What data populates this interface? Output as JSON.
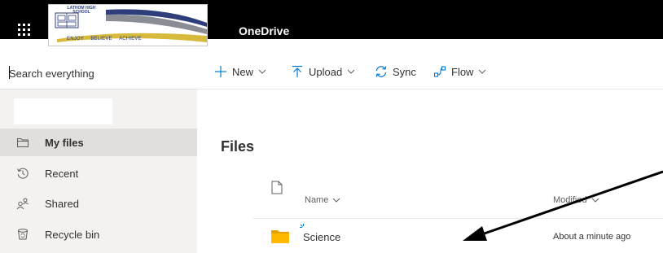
{
  "header": {
    "app_title": "OneDrive",
    "logo": {
      "school_name": "LATHOM HIGH SCHOOL",
      "motto_words": [
        "ENJOY",
        "BELIEVE",
        "ACHIEVE"
      ],
      "motto_separator": "•"
    }
  },
  "search": {
    "placeholder": "Search everything"
  },
  "nav": {
    "items": [
      {
        "label": "My files",
        "icon": "folder-outline-icon",
        "selected": true
      },
      {
        "label": "Recent",
        "icon": "history-icon",
        "selected": false
      },
      {
        "label": "Shared",
        "icon": "people-icon",
        "selected": false
      },
      {
        "label": "Recycle bin",
        "icon": "recycle-bin-icon",
        "selected": false
      }
    ]
  },
  "commands": {
    "new": "New",
    "upload": "Upload",
    "sync": "Sync",
    "flow": "Flow"
  },
  "main": {
    "title": "Files",
    "columns": {
      "name": "Name",
      "modified": "Modified"
    },
    "rows": [
      {
        "name": "Science",
        "modified": "About a minute ago",
        "type": "folder",
        "is_new": true
      }
    ]
  },
  "colors": {
    "accent": "#0078d4",
    "topbar": "#000000",
    "nav_bg": "#f3f2f1",
    "nav_selected": "#e1dfdd",
    "folder": "#ffb900",
    "logo_navy": "#2d3e7a",
    "logo_gold": "#d7b93c"
  }
}
